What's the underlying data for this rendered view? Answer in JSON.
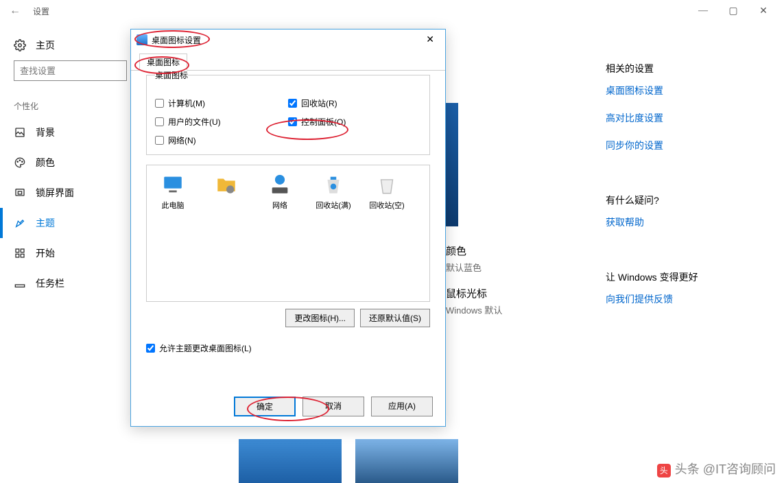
{
  "titlebar": {
    "title": "设置"
  },
  "sidebar": {
    "home": "主页",
    "search_placeholder": "查找设置",
    "section": "个性化",
    "items": [
      {
        "label": "背景"
      },
      {
        "label": "颜色"
      },
      {
        "label": "锁屏界面"
      },
      {
        "label": "主题"
      },
      {
        "label": "开始"
      },
      {
        "label": "任务栏"
      }
    ]
  },
  "center": {
    "color_h": "颜色",
    "color_sub": "默认蓝色",
    "cursor_h": "鼠标光标",
    "cursor_sub": "Windows 默认"
  },
  "right": {
    "related_h": "相关的设置",
    "links": [
      "桌面图标设置",
      "高对比度设置",
      "同步你的设置"
    ],
    "help_h": "有什么疑问?",
    "help_link": "获取帮助",
    "feedback_h": "让 Windows 变得更好",
    "feedback_link": "向我们提供反馈"
  },
  "dialog": {
    "title": "桌面图标设置",
    "tab": "桌面图标",
    "group": "桌面图标",
    "checks": {
      "computer": "计算机(M)",
      "userfiles": "用户的文件(U)",
      "network": "网络(N)",
      "recycle": "回收站(R)",
      "control": "控制面板(O)"
    },
    "icons": {
      "pc": "此电脑",
      "user": "",
      "net": "网络",
      "bin_full": "回收站(满)",
      "bin_empty": "回收站(空)"
    },
    "change_icon": "更改图标(H)...",
    "restore": "还原默认值(S)",
    "allow_theme": "允许主题更改桌面图标(L)",
    "ok": "确定",
    "cancel": "取消",
    "apply": "应用(A)"
  },
  "watermark": "头条 @IT咨询顾问"
}
